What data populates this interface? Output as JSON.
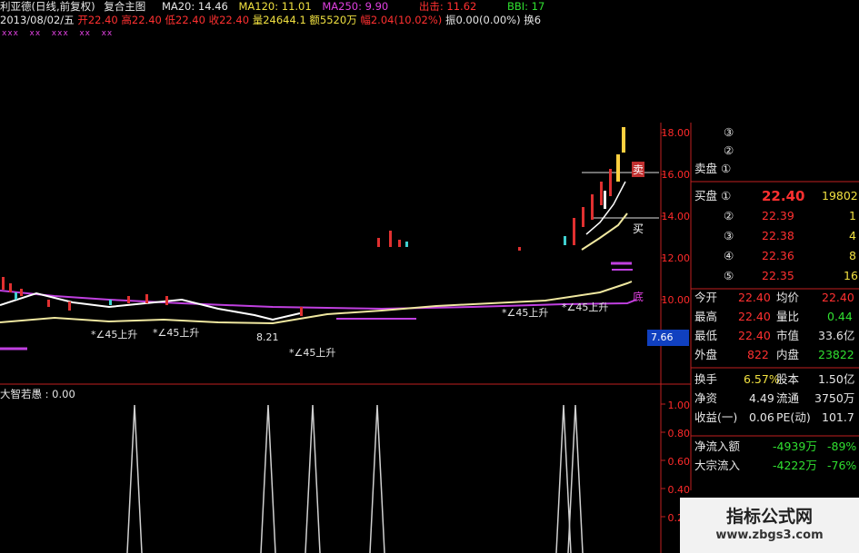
{
  "header": {
    "title": "利亚德(日线,前复权)",
    "mode": "复合主图",
    "ma20": "MA20: 14.46",
    "ma120": "MA120: 11.01",
    "ma250": "MA250: 9.90",
    "out": "出击: 11.62",
    "bbi": "BBI: 17",
    "date": "2013/08/02/五",
    "open": "开22.40",
    "high": "高22.40",
    "low": "低22.40",
    "close": "收22.40",
    "vol": "量24644.1",
    "amt": "额5520万",
    "chg": "幅2.04(10.02%)",
    "amp": "振0.00(0.00%)",
    "turn": "换6"
  },
  "markers": "xxx   xx   xxx   xx   xx",
  "price_axis": [
    "18.00",
    "16.00",
    "14.00",
    "12.00",
    "10.00"
  ],
  "current_price_tag": "7.66",
  "low_marker": "8.21",
  "annotations": [
    "*∠45上升",
    "*∠45上升",
    "*∠45上升",
    "*∠45上升",
    "*∠45上升"
  ],
  "chart_labels": {
    "sell": "卖",
    "buy": "买",
    "bottom": "底"
  },
  "indicator": {
    "name": "大智若愚 : 0.00",
    "axis": [
      "1.00",
      "0.80",
      "0.60",
      "0.40",
      "0.20"
    ]
  },
  "orderbook": {
    "sell": [
      {
        "label": "③",
        "price": "",
        "vol": ""
      },
      {
        "label": "②",
        "price": "",
        "vol": ""
      },
      {
        "label": "卖盘 ①",
        "price": "",
        "vol": ""
      }
    ],
    "buy": [
      {
        "label": "买盘 ①",
        "price": "22.40",
        "vol": "19802"
      },
      {
        "label": "②",
        "price": "22.39",
        "vol": "1"
      },
      {
        "label": "③",
        "price": "22.38",
        "vol": "4"
      },
      {
        "label": "④",
        "price": "22.36",
        "vol": "8"
      },
      {
        "label": "⑤",
        "price": "22.35",
        "vol": "16"
      }
    ]
  },
  "quote": [
    {
      "k1": "今开",
      "v1": "22.40",
      "k2": "均价",
      "v2": "22.40"
    },
    {
      "k1": "最高",
      "v1": "22.40",
      "k2": "量比",
      "v2": "0.44"
    },
    {
      "k1": "最低",
      "v1": "22.40",
      "k2": "市值",
      "v2": "33.6亿"
    },
    {
      "k1": "外盘",
      "v1": "822",
      "k2": "内盘",
      "v2": "23822"
    }
  ],
  "fund": [
    {
      "k1": "换手",
      "v1": "6.57%",
      "k2": "股本",
      "v2": "1.50亿"
    },
    {
      "k1": "净资",
      "v1": "4.49",
      "k2": "流通",
      "v2": "3750万"
    },
    {
      "k1": "收益(一)",
      "v1": "0.06",
      "k2": "PE(动)",
      "v2": "101.7"
    }
  ],
  "flow": [
    {
      "k": "净流入额",
      "v": "-4939万",
      "p": "-89%"
    },
    {
      "k": "大宗流入",
      "v": "-4222万",
      "p": "-76%"
    }
  ],
  "watermark": {
    "title": "指标公式网",
    "url": "www.zbgs3.com"
  }
}
